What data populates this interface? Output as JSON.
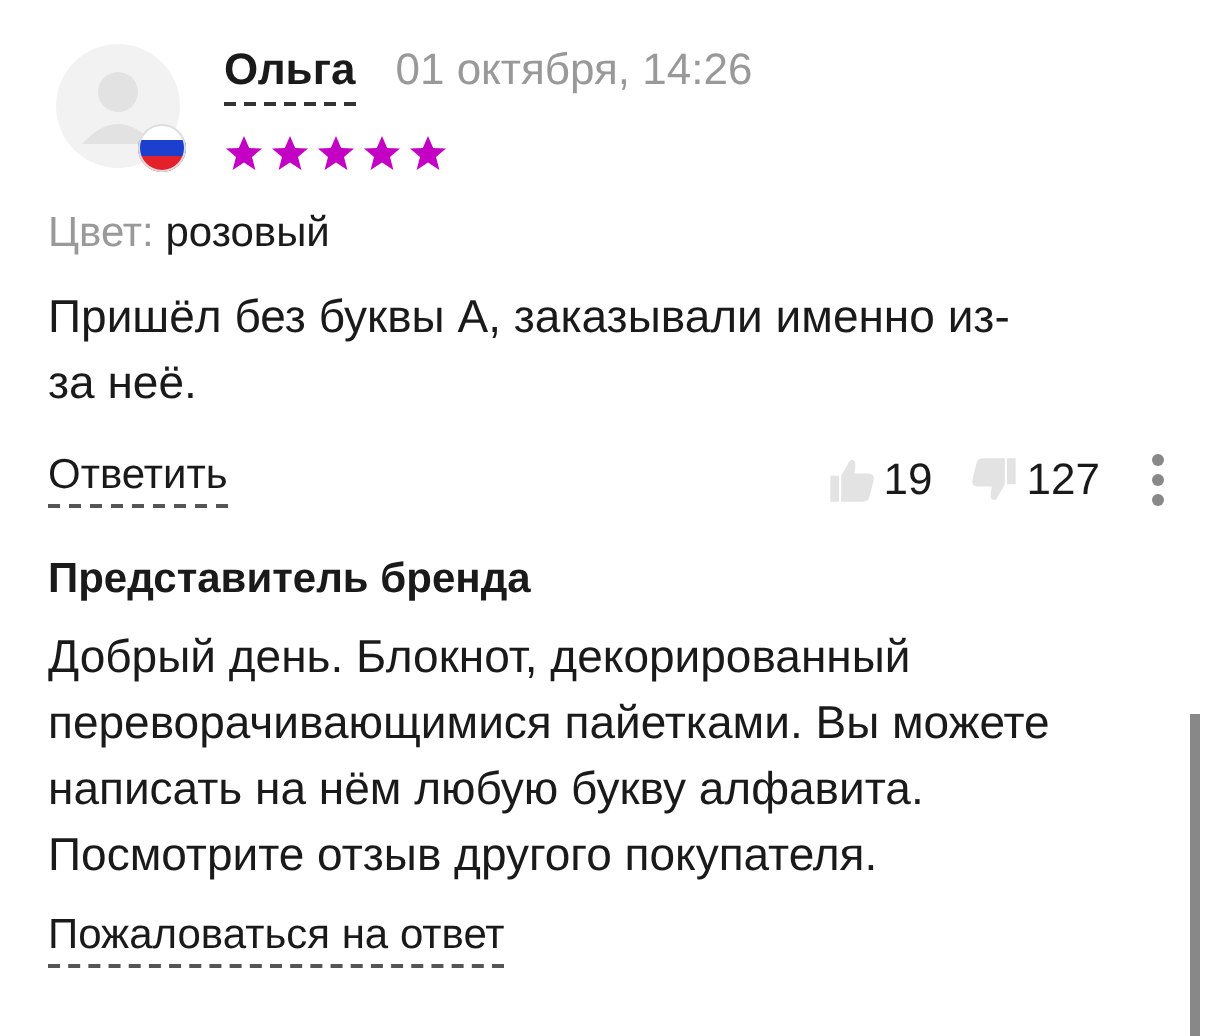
{
  "review": {
    "author": "Ольга",
    "date": "01 октября, 14:26",
    "stars": 5,
    "attributes": [
      {
        "label": "Цвет:",
        "value": "розовый"
      }
    ],
    "text": "Пришёл без буквы А, заказывали именно из-за неё.",
    "reply_link": "Ответить",
    "likes": "19",
    "dislikes": "127"
  },
  "brand_reply": {
    "title": "Представитель бренда",
    "text": "Добрый день. Блокнот, декорированный переворачивающимися пайетками. Вы можете написать на нём любую букву алфавита. Посмотрите отзыв другого покупателя.",
    "complain_link": "Пожаловаться на ответ"
  }
}
